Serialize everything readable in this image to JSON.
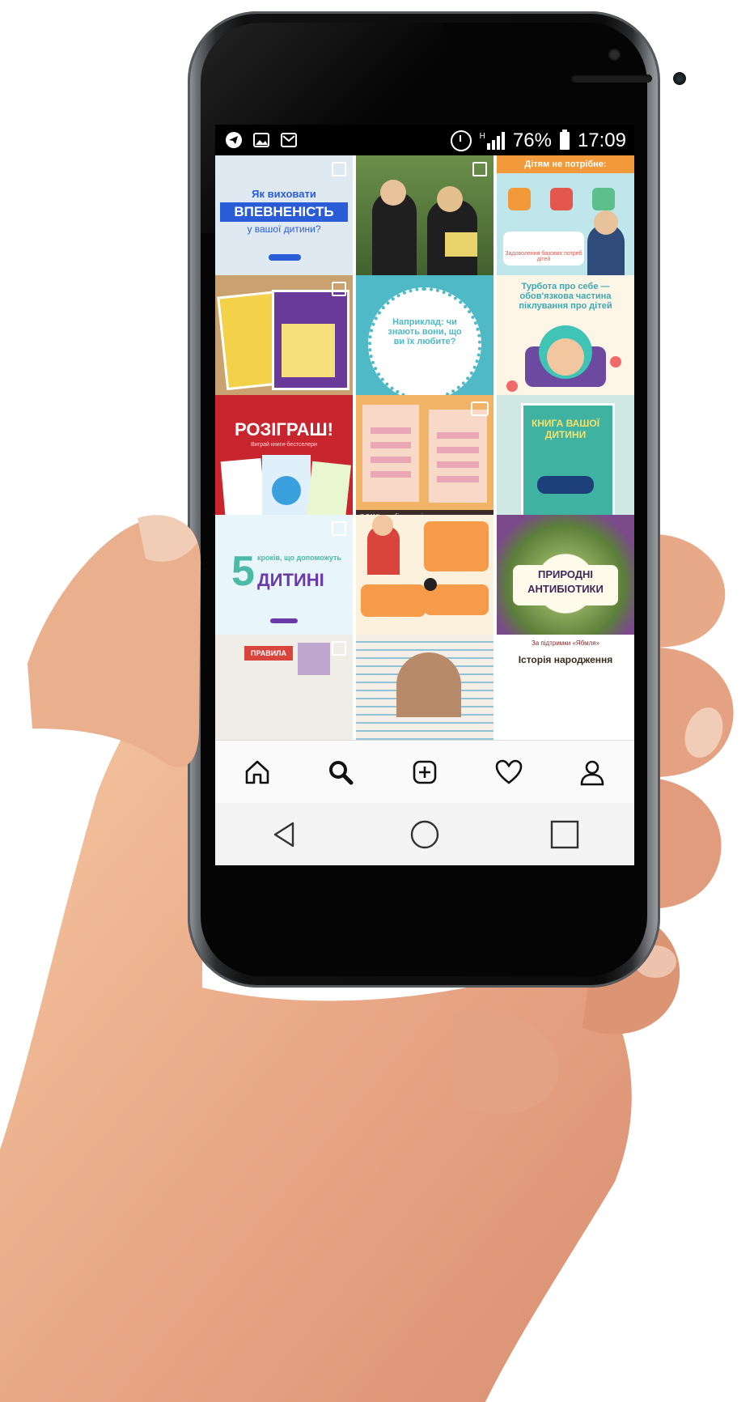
{
  "status_bar": {
    "left_icons": [
      "telegram-icon",
      "gallery-icon",
      "mail-icon"
    ],
    "network": "H",
    "battery_percent": "76%",
    "time": "17:09"
  },
  "feed": {
    "tiles": [
      {
        "id": "t1",
        "line1": "Як виховати",
        "line2": "ВПЕВНЕНІСТЬ",
        "line3": "у вашої дитини?"
      },
      {
        "id": "t2"
      },
      {
        "id": "t3",
        "header": "Дітям не потрібне:",
        "footer": "Задоволення базових потреб дітей"
      },
      {
        "id": "t4"
      },
      {
        "id": "t5",
        "body": "Наприклад: чи знають вони, що ви їх любите?"
      },
      {
        "id": "t6",
        "title": "Турбота про себе — обов'язкова частина піклування про дітей"
      },
      {
        "id": "t7",
        "title": "РОЗІГРАШ!",
        "subtitle": "Виграй книги-бестселери"
      },
      {
        "id": "t8",
        "caption": "Я САМ! — набір плакатів для навчання навичкам самообслуговування"
      },
      {
        "id": "t9",
        "book_title": "КНИГА ВАШОЇ ДИТИНИ"
      },
      {
        "id": "t10",
        "number": "5",
        "line1": "кроків, що допоможуть",
        "line2": "ДИТИНІ"
      },
      {
        "id": "t11"
      },
      {
        "id": "t12",
        "line1": "ПРИРОДНІ",
        "line2": "АНТИБІОТИКИ"
      },
      {
        "id": "t13",
        "label": "ПРАВИЛА"
      },
      {
        "id": "t14"
      },
      {
        "id": "t15",
        "small": "За підтримки «Ябмля»",
        "title": "Історія народження"
      }
    ]
  },
  "colors": {
    "accent_blue": "#2b5cd7",
    "orange": "#f29a3a",
    "teal": "#4fb9c6",
    "red": "#c8252e"
  }
}
